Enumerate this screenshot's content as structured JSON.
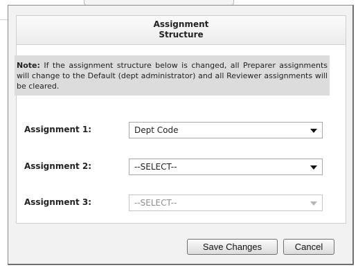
{
  "panel": {
    "title_line1": "Assignment",
    "title_line2": "Structure"
  },
  "note": {
    "label": "Note:",
    "text": " If the assignment structure below is changed, all Preparer assignments will change to the Default (dept administrator) and all Reviewer assignments will be cleared."
  },
  "assignments": [
    {
      "label": "Assignment 1:",
      "value": "Dept Code",
      "enabled": true
    },
    {
      "label": "Assignment 2:",
      "value": "--SELECT--",
      "enabled": true
    },
    {
      "label": "Assignment 3:",
      "value": "--SELECT--",
      "enabled": false
    }
  ],
  "buttons": {
    "save": "Save Changes",
    "cancel": "Cancel"
  },
  "icons": {
    "dropdown": "chevron-down-icon"
  }
}
